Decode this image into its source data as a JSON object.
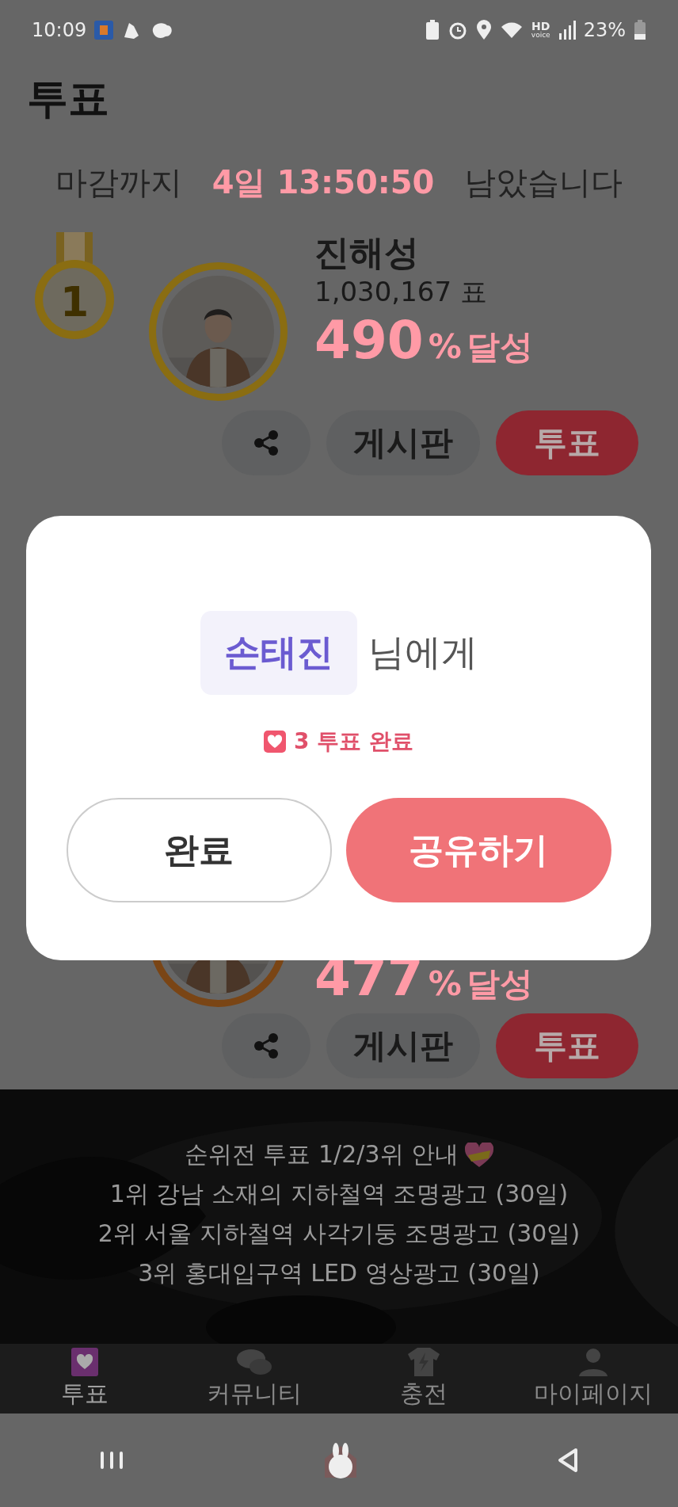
{
  "status_bar": {
    "time": "10:09",
    "hd": "HD",
    "voice": "voice",
    "battery": "23%"
  },
  "title": "투표",
  "countdown": {
    "prefix": "마감까지",
    "remaining": "4일 13:50:50",
    "suffix": "남았습니다"
  },
  "candidates": [
    {
      "rank": "1",
      "name": "진해성",
      "votes": "1,030,167 표",
      "percent": "490",
      "percent_sign": "%",
      "achieved": "달성",
      "board_label": "게시판",
      "vote_label": "투표",
      "color": "#8a6d12"
    },
    {
      "percent": "477",
      "percent_sign": "%",
      "achieved": "달성",
      "board_label": "게시판",
      "vote_label": "투표",
      "color": "#7a4515"
    }
  ],
  "dialog": {
    "recipient": "손태진",
    "recipient_suffix": "님에게",
    "result": "3 투표 완료",
    "buttons": [
      {
        "label": "완료",
        "kind": "secondary"
      },
      {
        "label": "공유하기",
        "kind": "primary"
      }
    ]
  },
  "banner": {
    "heading": "순위전 투표 1/2/3위 안내",
    "lines": [
      "1위 강남 소재의 지하철역 조명광고 (30일)",
      "2위 서울 지하철역 사각기둥 조명광고 (30일)",
      "3위 홍대입구역 LED 영상광고 (30일)"
    ]
  },
  "bottom_nav": [
    {
      "label": "투표",
      "selected": true
    },
    {
      "label": "커뮤니티",
      "selected": false
    },
    {
      "label": "충전",
      "selected": false
    },
    {
      "label": "마이페이지",
      "selected": false
    }
  ]
}
